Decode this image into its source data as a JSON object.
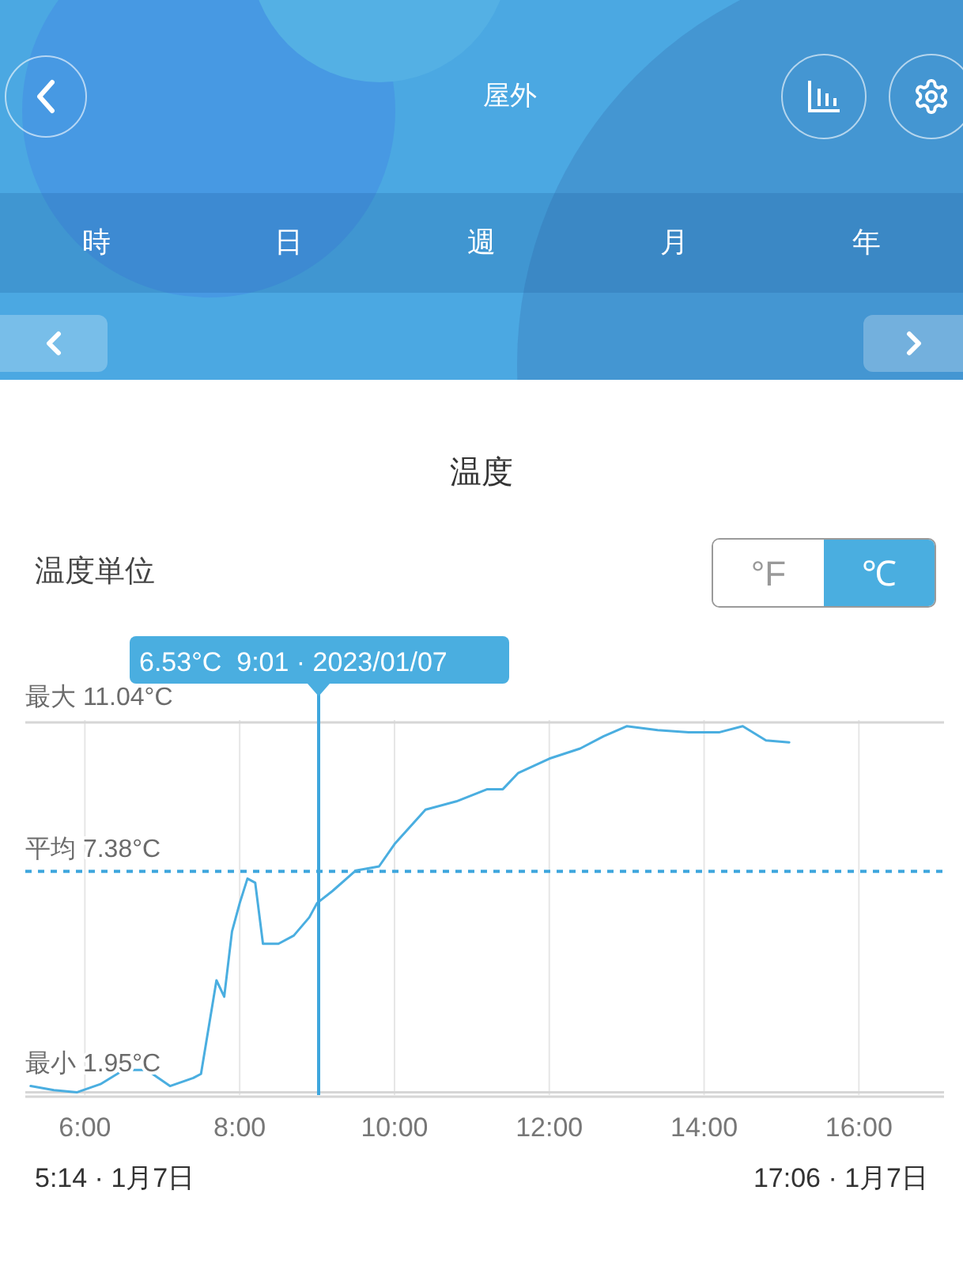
{
  "header": {
    "title": "屋外"
  },
  "tabs": [
    {
      "label": "時"
    },
    {
      "label": "日"
    },
    {
      "label": "週"
    },
    {
      "label": "月"
    },
    {
      "label": "年"
    }
  ],
  "unit": {
    "label": "温度単位",
    "options": [
      {
        "label": "°F",
        "selected": false
      },
      {
        "label": "℃",
        "selected": true
      }
    ]
  },
  "chart": {
    "chart_data": {
      "type": "line",
      "title": "温度",
      "x": [
        5.3,
        5.6,
        5.9,
        6.2,
        6.5,
        6.8,
        7.1,
        7.4,
        7.5,
        7.7,
        7.8,
        7.9,
        8.0,
        8.1,
        8.2,
        8.3,
        8.5,
        8.7,
        8.9,
        9.0,
        9.2,
        9.5,
        9.8,
        10.0,
        10.4,
        10.8,
        11.2,
        11.4,
        11.6,
        12.0,
        12.4,
        12.7,
        13.0,
        13.4,
        13.8,
        14.2,
        14.5,
        14.8,
        15.1
      ],
      "series": [
        {
          "color": "#4aaee0",
          "values": [
            2.1,
            2.0,
            1.95,
            2.15,
            2.5,
            2.5,
            2.1,
            2.3,
            2.4,
            4.7,
            4.3,
            5.9,
            6.6,
            7.2,
            7.1,
            5.6,
            5.6,
            5.8,
            6.25,
            6.6,
            6.9,
            7.4,
            7.5,
            8.05,
            8.9,
            9.1,
            9.4,
            9.4,
            9.8,
            10.15,
            10.4,
            10.7,
            10.95,
            10.85,
            10.8,
            10.8,
            10.95,
            10.6,
            10.55
          ]
        }
      ],
      "xlim": [
        5.23,
        17.1
      ],
      "ylim": [
        1.88,
        11.1
      ],
      "xticks": [
        {
          "value": 6,
          "label": "6:00"
        },
        {
          "value": 8,
          "label": "8:00"
        },
        {
          "value": 10,
          "label": "10:00"
        },
        {
          "value": 12,
          "label": "12:00"
        },
        {
          "value": 14,
          "label": "14:00"
        },
        {
          "value": 16,
          "label": "16:00"
        }
      ],
      "grid": true,
      "ref_lines": [
        {
          "axis": "y",
          "value": 11.04,
          "label": "最大 11.04°C"
        },
        {
          "axis": "y",
          "value": 7.38,
          "label": "平均 7.38°C"
        },
        {
          "axis": "y",
          "value": 1.95,
          "label": "最小 1.95°C"
        },
        {
          "axis": "x",
          "value": 9.02
        }
      ],
      "annotations": [
        "6.53°C  9:01 · 2023/01/07"
      ]
    },
    "range_start": "5:14 · 1月7日",
    "range_end": "17:06 · 1月7日"
  }
}
